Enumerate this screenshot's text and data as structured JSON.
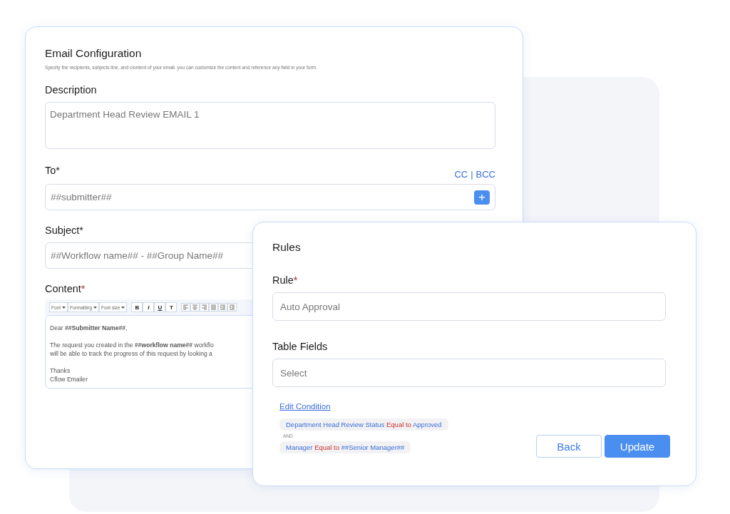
{
  "email_card": {
    "title": "Email Configuration",
    "subtitle": "Specify the recipients, subjects line, and ciontent of your email. you can customize the content and reference any field in your form.",
    "description": {
      "label": "Description",
      "value": "Department Head Review EMAIL 1"
    },
    "to": {
      "label": "To*",
      "value": "##submitter##",
      "cc": "CC",
      "separator": "|",
      "bcc": "BCC",
      "add_button": "+"
    },
    "subject": {
      "label": "Subject*",
      "value": "##Workflow name## - ##Group Name##"
    },
    "content": {
      "label": "Content",
      "required_mark": "*",
      "toolbar": {
        "dropdowns": [
          "Font",
          "Formatting",
          "Font size"
        ],
        "style_buttons": [
          "B",
          "I",
          "U",
          "T"
        ]
      },
      "lines": [
        {
          "kind": "text",
          "text": "Dear **##Submitter Name##**,"
        },
        {
          "kind": "blank"
        },
        {
          "kind": "text",
          "text": "The request you created in the **##workflow name##** workflo"
        },
        {
          "kind": "text",
          "text": "will be able to track the progress of this request by looking a"
        },
        {
          "kind": "blank"
        },
        {
          "kind": "text",
          "text": "Thanks"
        },
        {
          "kind": "text",
          "text": "Cflow Emailer"
        }
      ]
    }
  },
  "rules_card": {
    "title": "Rules",
    "rule": {
      "label": "Rule",
      "required_mark": "*",
      "value": "Auto Approval"
    },
    "table_fields": {
      "label": "Table Fields",
      "placeholder": "Select"
    },
    "edit_condition": "Edit Condition",
    "conditions": [
      {
        "parts": [
          {
            "kind": "field",
            "text": "Department Head Review Status"
          },
          {
            "kind": "operator",
            "text": "Equal to"
          },
          {
            "kind": "value",
            "text": "Approved"
          }
        ]
      },
      {
        "kind": "joiner",
        "text": "AND"
      },
      {
        "parts": [
          {
            "kind": "field",
            "text": "Manager"
          },
          {
            "kind": "operator",
            "text": "Equal to"
          },
          {
            "kind": "value",
            "text": "##Senior Manager##"
          }
        ]
      }
    ],
    "buttons": [
      {
        "label": "Back",
        "kind": "secondary"
      },
      {
        "label": "Update",
        "kind": "primary"
      }
    ]
  }
}
